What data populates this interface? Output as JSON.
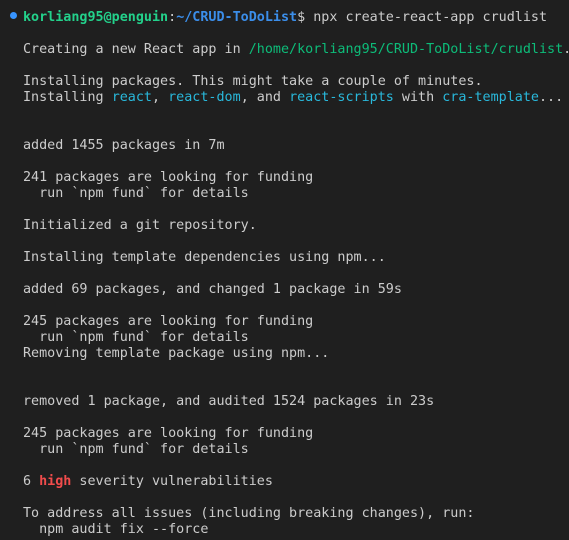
{
  "terminal": {
    "prompt": {
      "user_host": "korliang95@penguin",
      "separator": ":",
      "cwd": "~/CRUD-ToDoList",
      "symbol": "$ ",
      "command": "npx create-react-app crudlist"
    },
    "creating": {
      "prefix": "Creating a new React app in ",
      "path": "/home/korliang95/CRUD-ToDoList/crudlist",
      "suffix": "."
    },
    "installing_msg": "Installing packages. This might take a couple of minutes.",
    "installing_list": {
      "prefix": "Installing ",
      "pkg1": "react",
      "sep1": ", ",
      "pkg2": "react-dom",
      "sep2": ", and ",
      "pkg3": "react-scripts",
      "sep3": " with ",
      "pkg4": "cra-template",
      "suffix": "..."
    },
    "added_1455": "added 1455 packages in 7m",
    "funding_241": "241 packages are looking for funding",
    "fund_details_1": "  run `npm fund` for details",
    "git_init": "Initialized a git repository.",
    "template_deps": "Installing template dependencies using npm...",
    "added_69": "added 69 packages, and changed 1 package in 59s",
    "funding_245_a": "245 packages are looking for funding",
    "fund_details_2": "  run `npm fund` for details",
    "removing_template": "Removing template package using npm...",
    "removed_1": "removed 1 package, and audited 1524 packages in 23s",
    "funding_245_b": "245 packages are looking for funding",
    "fund_details_3": "  run `npm fund` for details",
    "vuln": {
      "count": "6 ",
      "severity": "high",
      "rest": " severity vulnerabilities"
    },
    "address_issues": "To address all issues (including breaking changes), run:",
    "audit_fix": "  npm audit fix --force"
  },
  "colors": {
    "background": "#1f1f1f",
    "foreground": "#cccccc",
    "user_host": "#23d18b",
    "cwd": "#3b8eea",
    "link": "#29b8db",
    "path_green": "#0dbc79",
    "high_red": "#f14c4c",
    "status_dot": "#3794ff"
  }
}
